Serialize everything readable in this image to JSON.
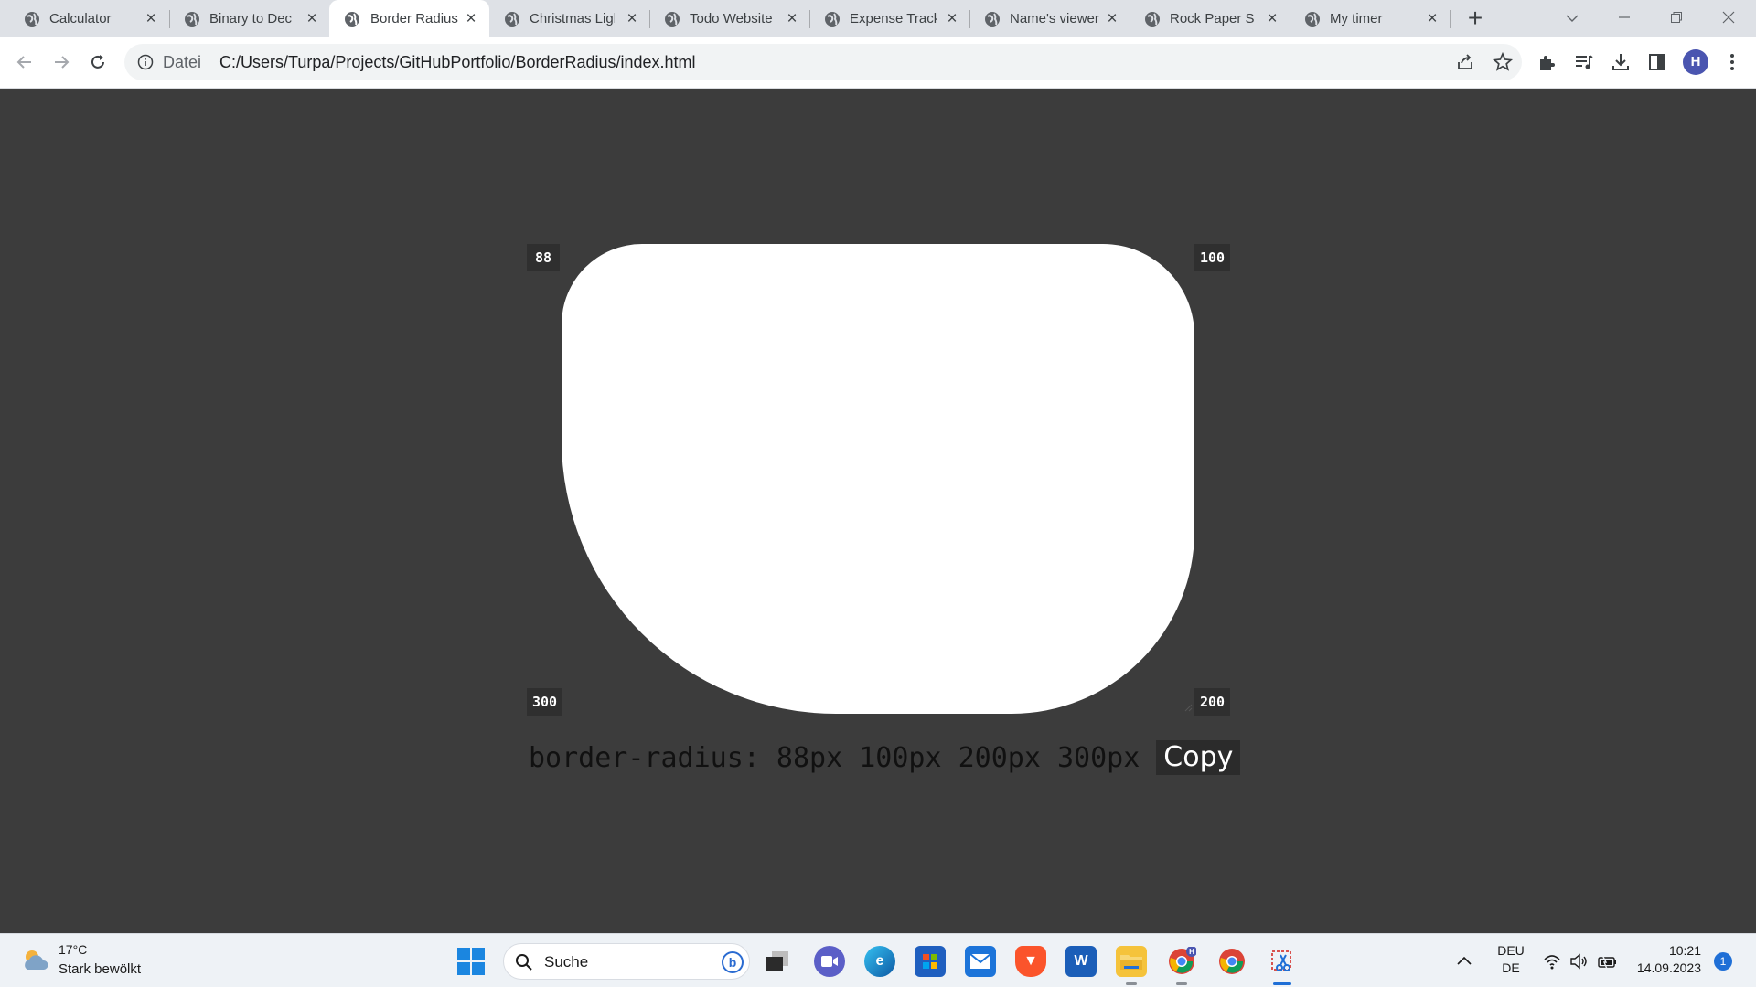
{
  "tabs": [
    {
      "title": "Calculator",
      "active": false
    },
    {
      "title": "Binary to Deci",
      "active": false
    },
    {
      "title": "Border Radius",
      "active": true
    },
    {
      "title": "Christmas Ligh",
      "active": false
    },
    {
      "title": "Todo Website",
      "active": false
    },
    {
      "title": "Expense Track",
      "active": false
    },
    {
      "title": "Name's viewer",
      "active": false
    },
    {
      "title": "Rock Paper Sc",
      "active": false
    },
    {
      "title": "My timer",
      "active": false
    }
  ],
  "toolbar": {
    "security_label": "Datei",
    "url": "C:/Users/Turpa/Projects/GitHubPortfolio/BorderRadius/index.html",
    "profile_initial": "H"
  },
  "page": {
    "corner_values": {
      "top_left": "88",
      "top_right": "100",
      "bottom_right": "200",
      "bottom_left": "300"
    },
    "css_output": "border-radius: 88px 100px 200px 300px",
    "copy_label": "Copy",
    "shape_color": "#ffffff",
    "background_color": "#3c3c3c"
  },
  "taskbar": {
    "weather_temp": "17°C",
    "weather_desc": "Stark bewölkt",
    "search_placeholder": "Suche",
    "language_line1": "DEU",
    "language_line2": "DE",
    "time": "10:21",
    "date": "14.09.2023",
    "notification_count": "1"
  }
}
